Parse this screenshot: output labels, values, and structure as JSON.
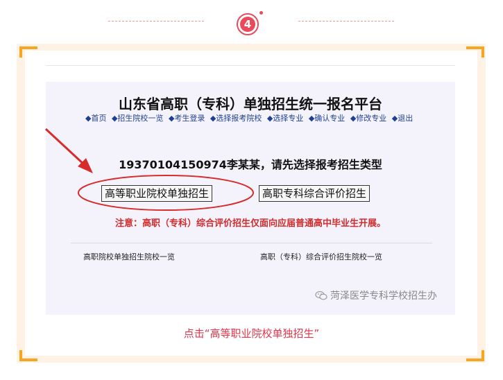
{
  "step": {
    "number": "4"
  },
  "screenshot": {
    "site_title": "山东省高职（专科）单独招生统一报名平台",
    "nav": [
      "◆首页",
      "◆招生院校一览",
      "◆考生登录",
      "◆选择报考院校",
      "◆选择专业",
      "◆确认专业",
      "◆修改专业",
      "◆退出"
    ],
    "prompt": "19370104150974李某某，请先选择报考招生类型",
    "buttons": {
      "independent": "高等职业院校单独招生",
      "comprehensive": "高职专科综合评价招生"
    },
    "note": "注意：高职（专科）综合评价招生仅面向应届普通高中毕业生开展。",
    "links": {
      "independent_list": "高职院校单独招生院校一览",
      "comprehensive_list": "高职（专科）综合评价招生院校一览"
    },
    "watermark": "菏泽医学专科学校招生办"
  },
  "caption": "点击“高等职业院校单独招生”",
  "colors": {
    "accent_red": "#e94a5c",
    "frame_bg": "#fdf2e4",
    "corner_orange": "#f6a623",
    "annotation_red": "#d62c2c",
    "nav_blue": "#1e3f95"
  }
}
